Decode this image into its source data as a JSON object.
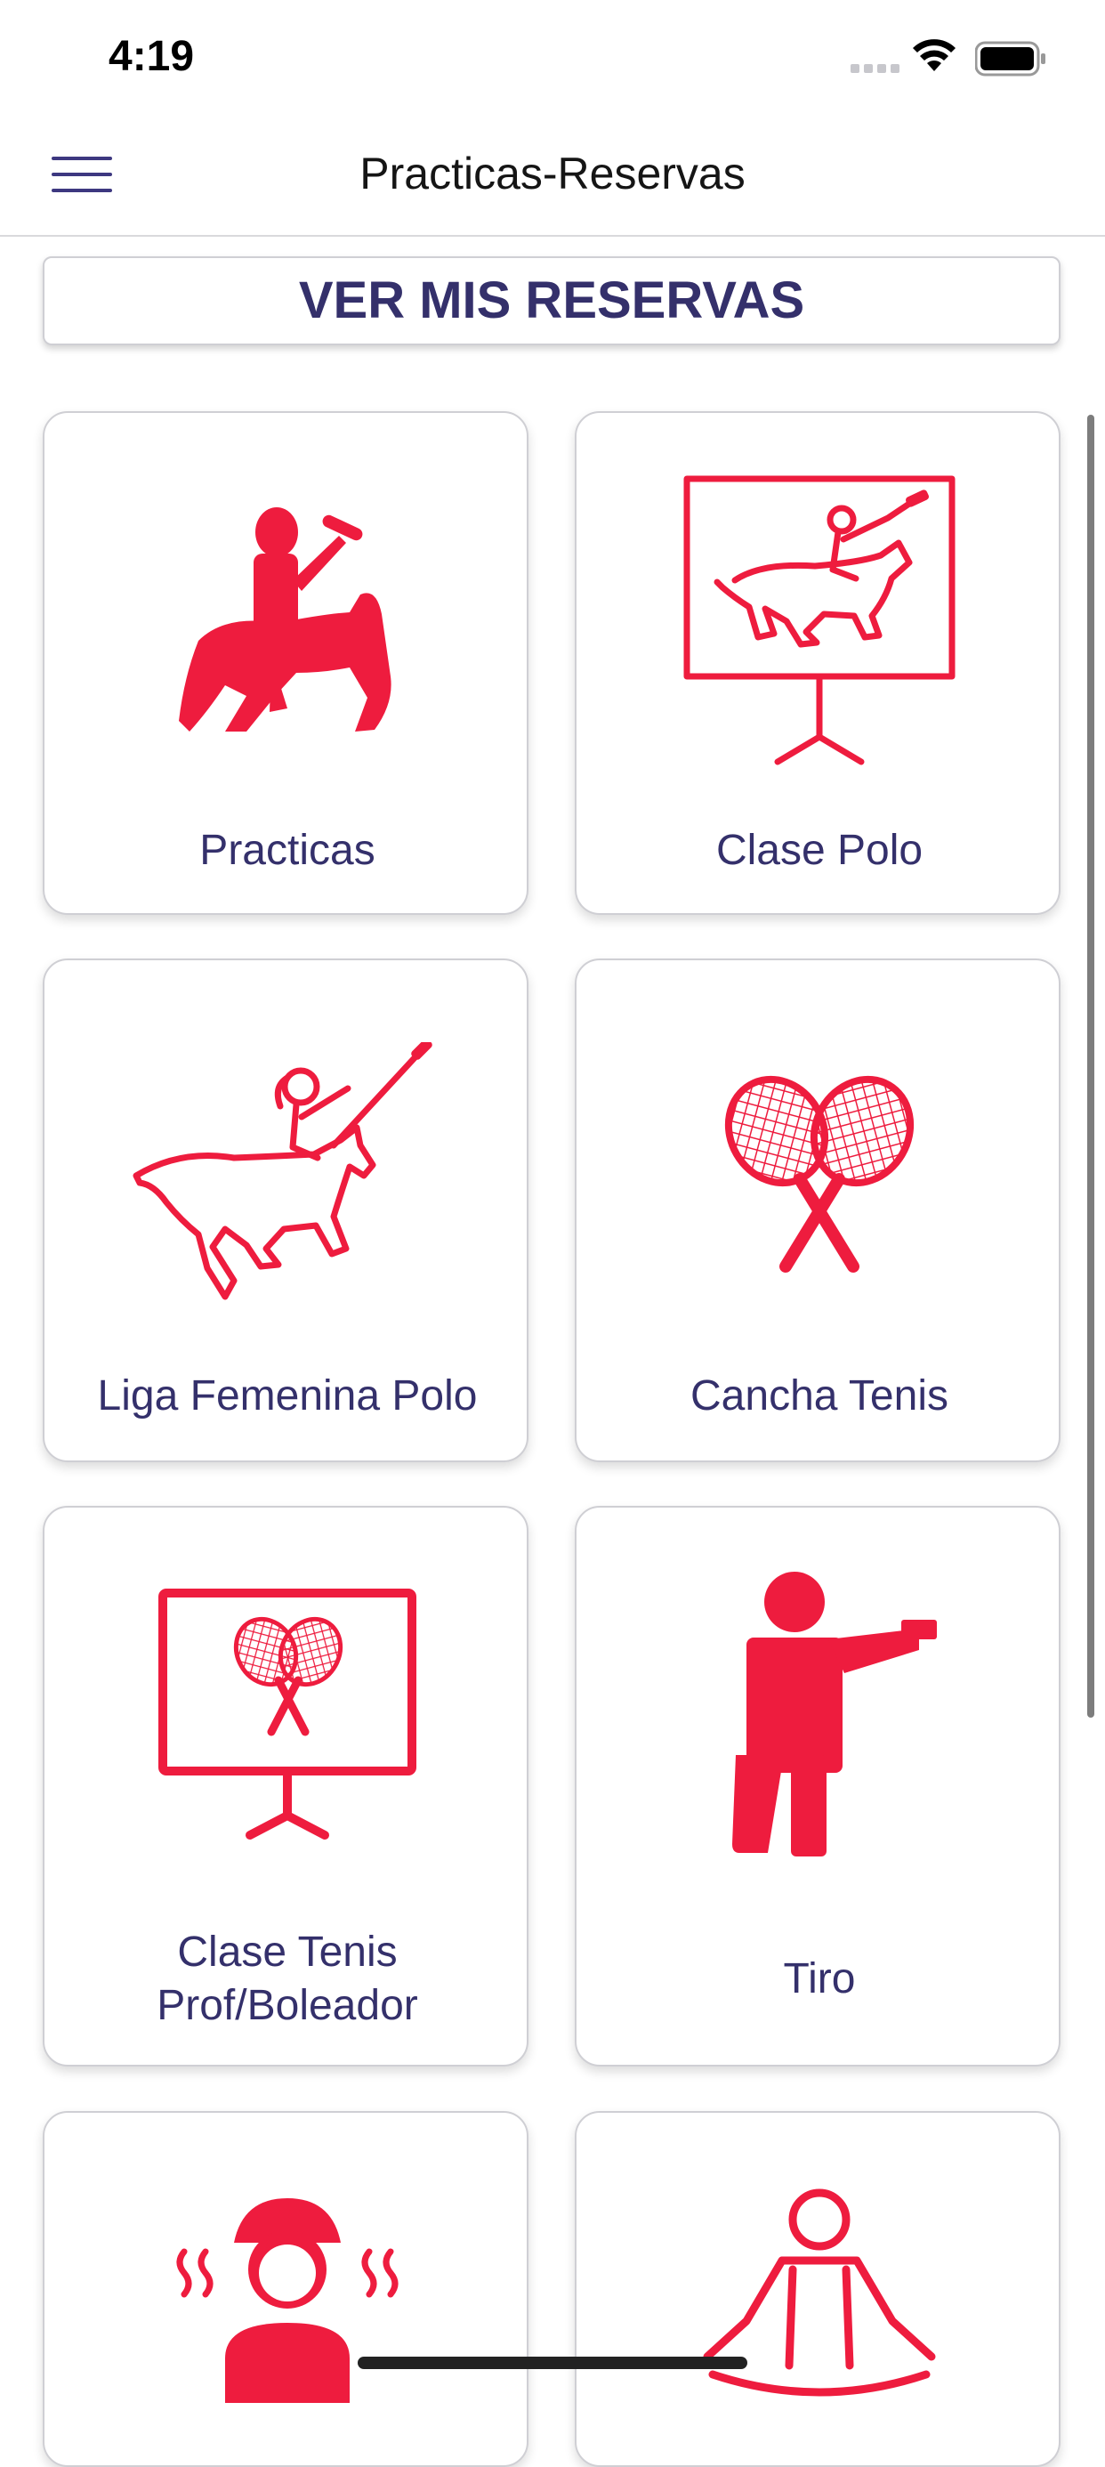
{
  "status_bar": {
    "time": "4:19"
  },
  "nav": {
    "title": "Practicas-Reservas"
  },
  "reservas_button": {
    "label": "VER MIS RESERVAS"
  },
  "cards": [
    {
      "label": "Practicas",
      "icon": "polo-rider-solid-icon"
    },
    {
      "label": "Clase Polo",
      "icon": "polo-class-board-icon"
    },
    {
      "label": "Liga Femenina Polo",
      "icon": "female-polo-rider-icon"
    },
    {
      "label": "Cancha Tenis",
      "icon": "crossed-tennis-rackets-icon"
    },
    {
      "label_line1": "Clase Tenis",
      "label_line2": "Prof/Boleador",
      "icon": "tennis-class-board-icon"
    },
    {
      "label": "Tiro",
      "icon": "shooter-icon"
    },
    {
      "label": "",
      "icon": "spa-sauna-icon"
    },
    {
      "label": "",
      "icon": "yoga-meditation-icon"
    }
  ],
  "colors": {
    "accent": "#ee1c3e",
    "text_primary": "#34306b"
  }
}
